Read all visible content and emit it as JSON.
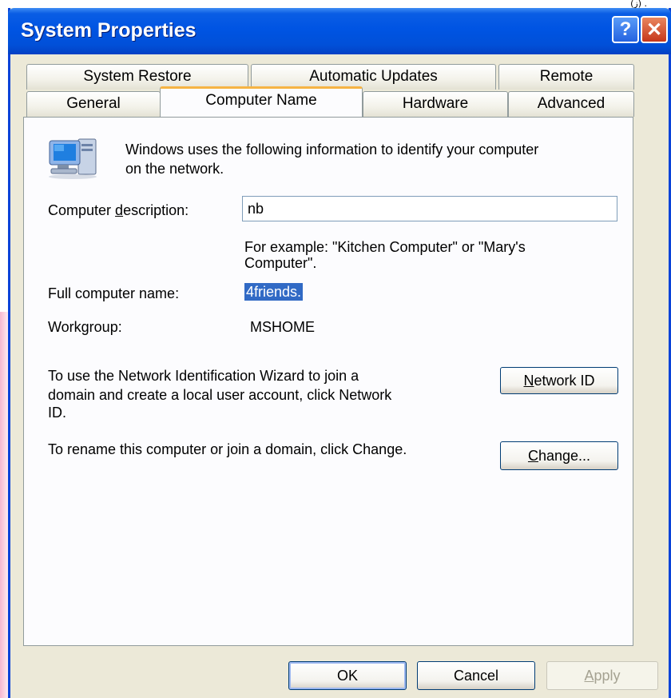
{
  "window": {
    "title": "System Properties",
    "help_glyph": "?",
    "close_glyph": "✕"
  },
  "top_scrap": "(ز) .",
  "tabs_back": [
    "System Restore",
    "Automatic Updates",
    "Remote"
  ],
  "tabs_front": [
    "General",
    "Computer Name",
    "Hardware",
    "Advanced"
  ],
  "active_tab": "Computer Name",
  "info": {
    "line1": "Windows uses the following information to identify your computer",
    "line2": "on the network."
  },
  "description": {
    "label_pre": "Computer ",
    "label_accel": "d",
    "label_post": "escription:",
    "value": "nb",
    "example_line1": "For example: \"Kitchen Computer\" or \"Mary's",
    "example_line2": "Computer\"."
  },
  "full_name": {
    "label": "Full computer name:",
    "value": "4friends."
  },
  "workgroup": {
    "label": "Workgroup:",
    "value": "MSHOME"
  },
  "network_id": {
    "text_line1": "To use the Network Identification Wizard to join a",
    "text_line2": "domain and create a local user account, click Network",
    "text_line3": "ID.",
    "button_accel": "N",
    "button_rest": "etwork ID"
  },
  "change": {
    "text": "To rename this computer or join a domain, click Change.",
    "button_accel": "C",
    "button_rest": "hange..."
  },
  "footer": {
    "ok": "OK",
    "cancel": "Cancel",
    "apply_accel": "A",
    "apply_rest": "pply"
  },
  "icons": {
    "computer": "computer-network-icon"
  },
  "colors": {
    "titlebar": "#0054e3",
    "face": "#ece9d8",
    "selection": "#316ac5",
    "tab_highlight": "#f6b444"
  }
}
